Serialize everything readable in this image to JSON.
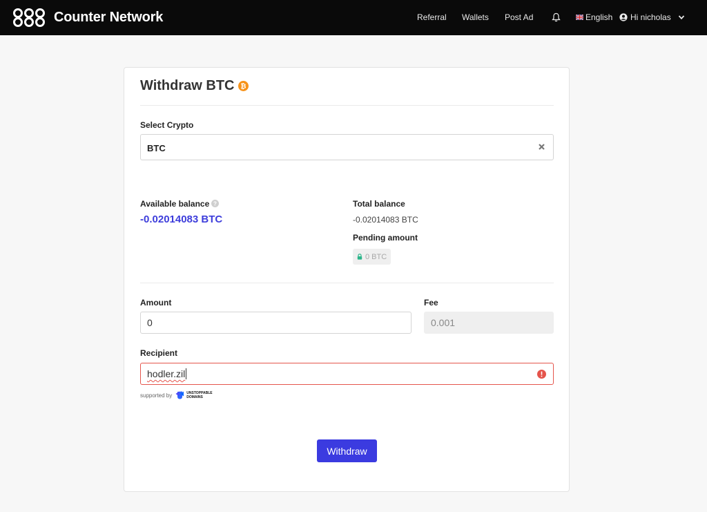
{
  "header": {
    "brand": "Counter Network",
    "nav": [
      "Referral",
      "Wallets",
      "Post Ad"
    ],
    "language": "English",
    "greeting": "Hi nicholas"
  },
  "form": {
    "title": "Withdraw BTC",
    "select_label": "Select Crypto",
    "select_value": "BTC",
    "available_label": "Available balance",
    "available_value": "-0.02014083 BTC",
    "total_label": "Total balance",
    "total_value": "-0.02014083 BTC",
    "pending_label": "Pending amount",
    "pending_value": "0 BTC",
    "amount_label": "Amount",
    "amount_value": "0",
    "fee_label": "Fee",
    "fee_value": "0.001",
    "recipient_label": "Recipient",
    "recipient_value": "hodler.zil",
    "supported_by": "supported by",
    "ud_brand": "UNSTOPPABLE DOMAINS",
    "submit_label": "Withdraw"
  },
  "colors": {
    "accent": "#3b3be0",
    "balance": "#3d3ddb",
    "error": "#e5544b",
    "bitcoin": "#f7931a",
    "navbar": "#0a0a0a"
  },
  "icons": [
    "counter-network-logo-icon",
    "bell-icon",
    "uk-flag-icon",
    "user-icon",
    "chevron-down-icon",
    "bitcoin-icon",
    "clear-icon",
    "help-icon",
    "lock-icon",
    "error-icon",
    "unstoppable-domains-logo-icon"
  ]
}
